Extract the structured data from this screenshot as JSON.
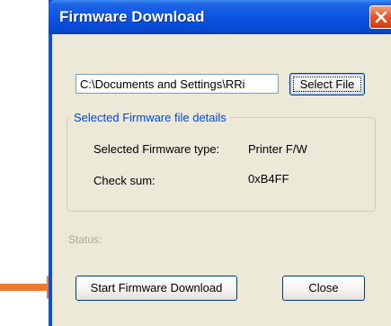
{
  "window": {
    "title": "Firmware Download"
  },
  "file": {
    "path_value": "C:\\Documents and Settings\\RRi",
    "select_button": "Select File"
  },
  "details": {
    "legend": "Selected Firmware file details",
    "type_label": "Selected Firmware type:",
    "type_value": "Printer F/W",
    "checksum_label": "Check sum:",
    "checksum_value": "0xB4FF"
  },
  "status": {
    "label": "Status:"
  },
  "actions": {
    "start_button": "Start Firmware Download",
    "close_button": "Close"
  },
  "colors": {
    "titlebar": "#0a54e2",
    "dialog_bg": "#ece9d8",
    "legend_text": "#0046d5",
    "arrow": "#f07a2c"
  }
}
